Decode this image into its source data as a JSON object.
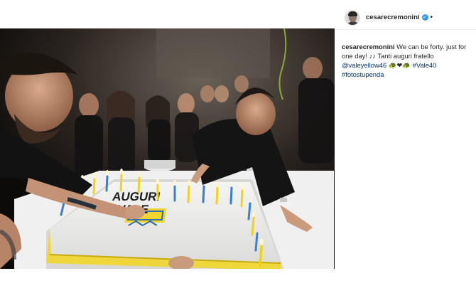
{
  "post": {
    "username": "cesarecremonini",
    "verified_badge": "✓",
    "more_dot": "•",
    "caption": {
      "author": "cesarecremonini",
      "text_1": " We can be forty. just for one day! ♪♪ Tanti auguri fratello ",
      "mention": "@valeyellow46",
      "emojis": " 🐢❤🐢 ",
      "hashtag_1": "#Vale40",
      "hashtag_2": "#fotostupenda"
    }
  },
  "photo": {
    "cake_text_line1": "AUGURI",
    "cake_text_line2": "VALE"
  },
  "colors": {
    "link": "#003569",
    "verified": "#3897f0",
    "cake_yellow": "#f2d31b",
    "cake_blue": "#2f6fb0"
  },
  "icons": {
    "verified": "verified-badge-icon",
    "avatar": "avatar-icon"
  }
}
